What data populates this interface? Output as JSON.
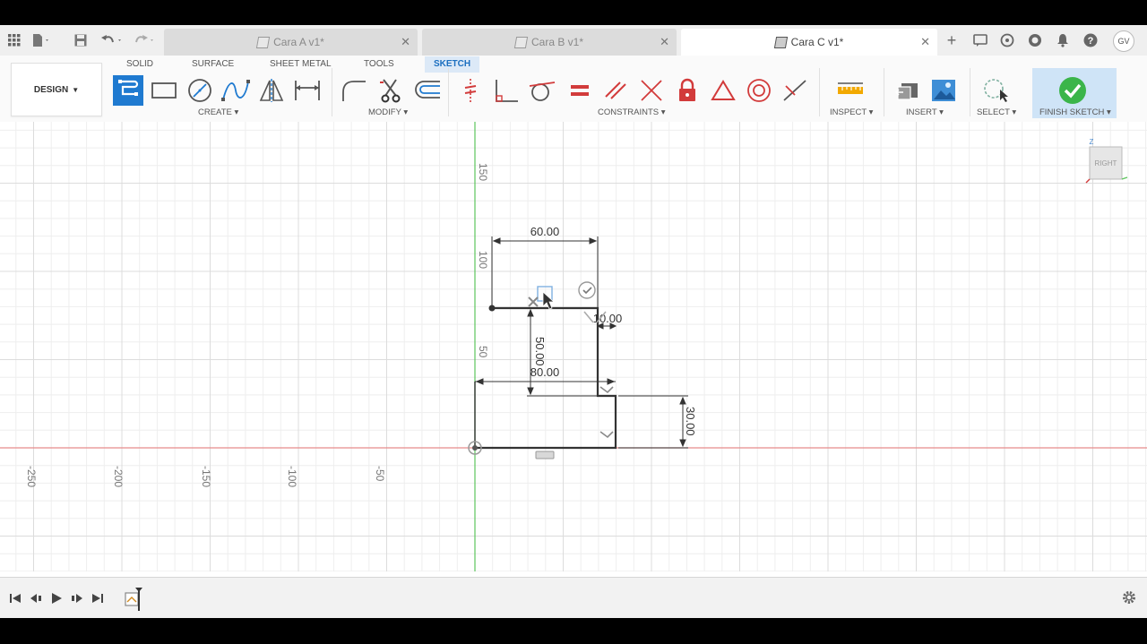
{
  "tabs": [
    {
      "label": "Cara A v1*"
    },
    {
      "label": "Cara B v1*"
    },
    {
      "label": "Cara C v1*"
    }
  ],
  "user": {
    "initials": "GV"
  },
  "workspace": {
    "label": "DESIGN"
  },
  "ribbon_tabs": [
    "SOLID",
    "SURFACE",
    "SHEET METAL",
    "TOOLS",
    "SKETCH"
  ],
  "active_ribbon_tab": "SKETCH",
  "groups": {
    "create": "CREATE",
    "modify": "MODIFY",
    "constraints": "CONSTRAINTS",
    "inspect": "INSPECT",
    "insert": "INSERT",
    "select": "SELECT",
    "finish": "FINISH SKETCH"
  },
  "viewcube": {
    "face": "RIGHT",
    "axis": "Z"
  },
  "axis_labels": {
    "x": [
      "-250",
      "-200",
      "-150",
      "-100",
      "-50"
    ],
    "y": [
      "150",
      "100",
      "50"
    ]
  },
  "dimensions": {
    "top_width": "60.00",
    "step": "10.00",
    "inner_height": "50.00",
    "base_width": "80.00",
    "base_height": "30.00"
  },
  "colors": {
    "accent": "#1f7ad0",
    "sketch_tab_bg": "#dce9f7",
    "finish_green": "#3bb54a",
    "x_axis": "#e88a8a",
    "y_axis": "#5cc45c",
    "constraint_red": "#d23b3b"
  }
}
